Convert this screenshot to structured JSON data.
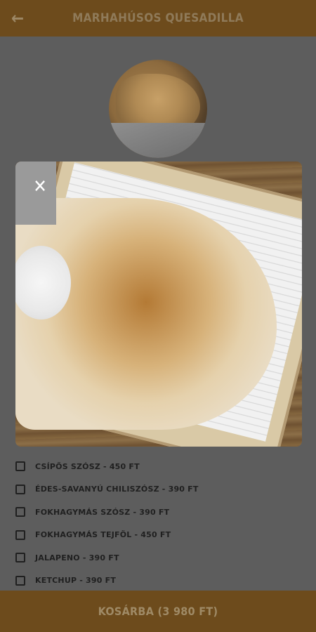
{
  "header": {
    "title": "MARHAHÚSOS QUESADILLA"
  },
  "icons": {
    "back": "arrow-left-icon",
    "close": "close-icon"
  },
  "options": [
    {
      "label": "CSÍPŐS SZÓSZ - 450 FT"
    },
    {
      "label": "ÉDES-SAVANYÚ CHILISZÓSZ - 390 FT"
    },
    {
      "label": "FOKHAGYMÁS SZÓSZ - 390 FT"
    },
    {
      "label": "FOKHAGYMÁS TEJFÖL - 450 FT"
    },
    {
      "label": "JALAPENO - 390 FT"
    },
    {
      "label": "KETCHUP - 390 FT"
    }
  ],
  "footer": {
    "cart_label": "KOSÁRBA (3 980 FT)"
  },
  "colors": {
    "header_bg": "#6d4b1c",
    "footer_bg": "#6d4b1c",
    "content_bg": "#5d5d5d"
  }
}
